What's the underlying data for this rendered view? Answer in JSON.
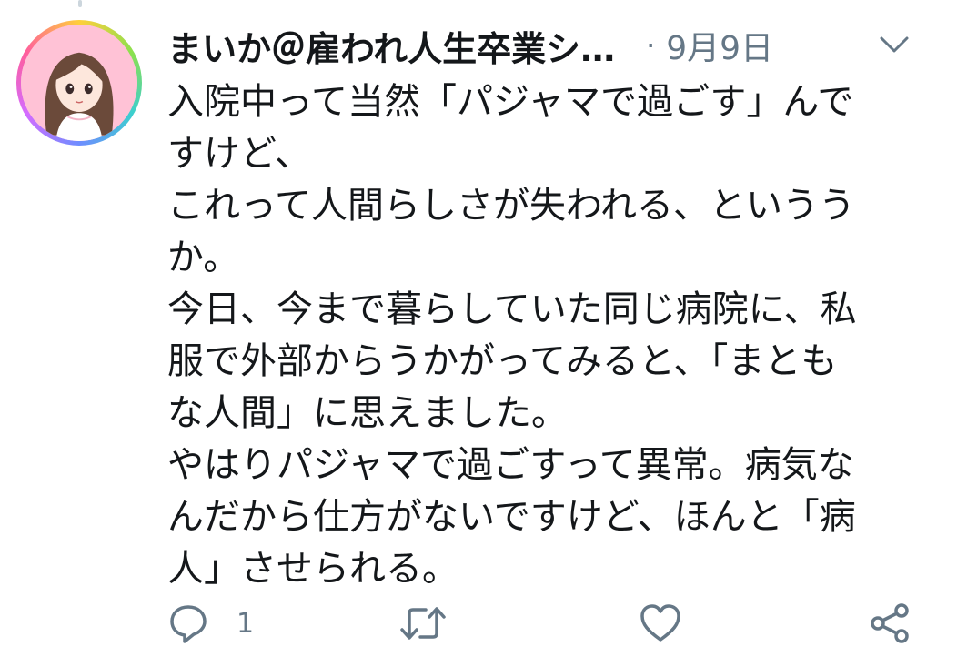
{
  "tweet": {
    "author": {
      "display_name": "まいか＠雇われ人生卒業シ…",
      "avatar_icon": "avatar-illustration-icon"
    },
    "separator": "·",
    "date": "9月9日",
    "menu_icon": "chevron-down-icon",
    "text_lines": [
      "入院中って当然「パジャマで過ごす」んで",
      "すけど、",
      "これって人間らしさが失われる、というう",
      "か。",
      "今日、今まで暮らしていた同じ病院に、私",
      "服で外部からうかがってみると、「まとも",
      "な人間」に思えました。",
      "やはりパジャマで過ごすって異常。病気な",
      "んだから仕方がないですけど、ほんと「病",
      "人」させられる。"
    ],
    "actions": {
      "reply_icon": "reply-icon",
      "reply_count": "1",
      "retweet_icon": "retweet-icon",
      "like_icon": "heart-icon",
      "share_icon": "share-icon"
    },
    "colors": {
      "text": "#14171a",
      "muted": "#657786",
      "avatar_bg": "#ffc2d6"
    }
  }
}
